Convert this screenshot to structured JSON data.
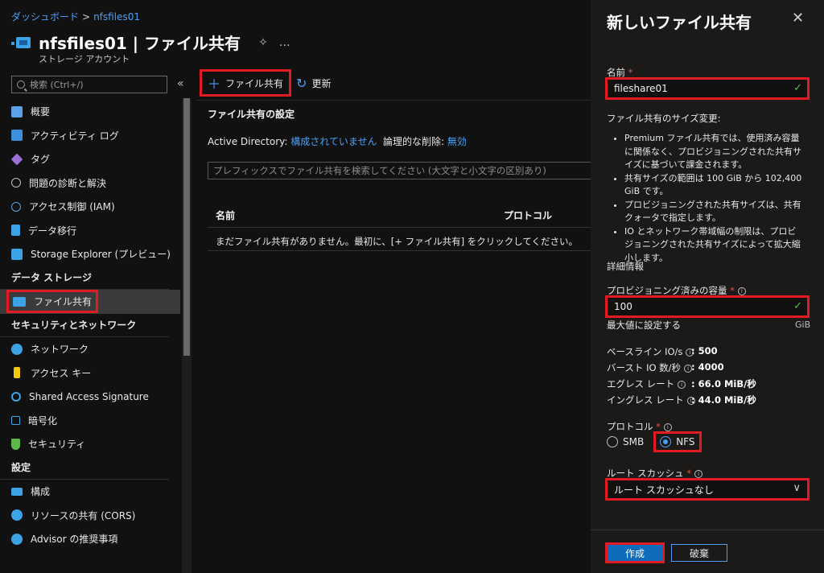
{
  "breadcrumb": {
    "home": "ダッシュボード",
    "current": "nfsfiles01"
  },
  "header": {
    "title": "nfsfiles01 | ファイル共有",
    "subtitle": "ストレージ アカウント",
    "pin_icon": "pin-icon",
    "more": "…"
  },
  "sidebar": {
    "search_placeholder": "検索 (Ctrl+/)",
    "items_top": [
      {
        "label": "概要",
        "icon": "overview-icon",
        "color": "#5aa3e8"
      },
      {
        "label": "アクティビティ ログ",
        "icon": "activity-log-icon",
        "color": "#3b8fdc"
      },
      {
        "label": "タグ",
        "icon": "tag-icon",
        "color": "#9b6fd6"
      },
      {
        "label": "問題の診断と解決",
        "icon": "wrench-icon",
        "color": "#bdbdbd"
      },
      {
        "label": "アクセス制御 (IAM)",
        "icon": "iam-icon",
        "color": "#5aa3e8"
      },
      {
        "label": "データ移行",
        "icon": "migration-icon",
        "color": "#3ba3e6"
      },
      {
        "label": "Storage Explorer (プレビュー)",
        "icon": "storage-explorer-icon",
        "color": "#3ba3e6"
      }
    ],
    "section_data": "データ ストレージ",
    "item_file_share": "ファイル共有",
    "section_security": "セキュリティとネットワーク",
    "items_security": [
      {
        "label": "ネットワーク",
        "icon": "network-icon",
        "color": "#3ba3e6"
      },
      {
        "label": "アクセス キー",
        "icon": "key-icon",
        "color": "#f2c811"
      },
      {
        "label": "Shared Access Signature",
        "icon": "link-icon",
        "color": "#3ba3e6"
      },
      {
        "label": "暗号化",
        "icon": "lock-icon",
        "color": "#3ba3e6"
      },
      {
        "label": "セキュリティ",
        "icon": "shield-icon",
        "color": "#5fb94a"
      }
    ],
    "section_settings": "設定",
    "items_settings": [
      {
        "label": "構成",
        "icon": "config-icon",
        "color": "#3ba3e6"
      },
      {
        "label": "リソースの共有 (CORS)",
        "icon": "cors-icon",
        "color": "#3ba3e6"
      },
      {
        "label": "Advisor の推奨事項",
        "icon": "advisor-icon",
        "color": "#3ba3e6"
      }
    ]
  },
  "toolbar": {
    "add_label": "ファイル共有",
    "refresh_label": "更新"
  },
  "main": {
    "settings_title": "ファイル共有の設定",
    "ad_label": "Active Directory:",
    "ad_value": "構成されていません",
    "delete_label": "論理的な削除:",
    "delete_value": "無効",
    "filter_placeholder": "プレフィックスでファイル共有を検索してください (大文字と小文字の区別あり)",
    "columns": [
      "名前",
      "プロトコル"
    ],
    "empty_message": "まだファイル共有がありません。最初に、[+ ファイル共有] をクリックしてください。"
  },
  "panel": {
    "title": "新しいファイル共有",
    "name_label": "名前",
    "name_value": "fileshare01",
    "size_heading": "ファイル共有のサイズ変更:",
    "bullets": [
      "Premium ファイル共有では、使用済み容量に関係なく、プロビジョニングされた共有サイズに基づいて課金されます。",
      "共有サイズの範囲は 100 GiB から 102,400 GiB です。",
      "プロビジョニングされた共有サイズは、共有クォータで指定します。",
      "IO とネットワーク帯域幅の制限は、プロビジョニングされた共有サイズによって拡大縮小します。"
    ],
    "details_link": "詳細情報",
    "capacity_label": "プロビジョニング済みの容量",
    "capacity_value": "100",
    "max_link": "最大値に設定する",
    "unit": "GiB",
    "metrics": [
      {
        "label": "ベースライン IO/s",
        "value": ": 500"
      },
      {
        "label": "バースト IO 数/秒",
        "value": ": 4000"
      },
      {
        "label": "エグレス レート",
        "value": ": 66.0 MiB/秒"
      },
      {
        "label": "イングレス レート",
        "value": ": 44.0 MiB/秒"
      }
    ],
    "protocol_label": "プロトコル",
    "protocol_options": [
      "SMB",
      "NFS"
    ],
    "protocol_selected": "NFS",
    "root_squash_label": "ルート スカッシュ",
    "root_squash_value": "ルート スカッシュなし",
    "create_button": "作成",
    "discard_button": "破棄"
  }
}
